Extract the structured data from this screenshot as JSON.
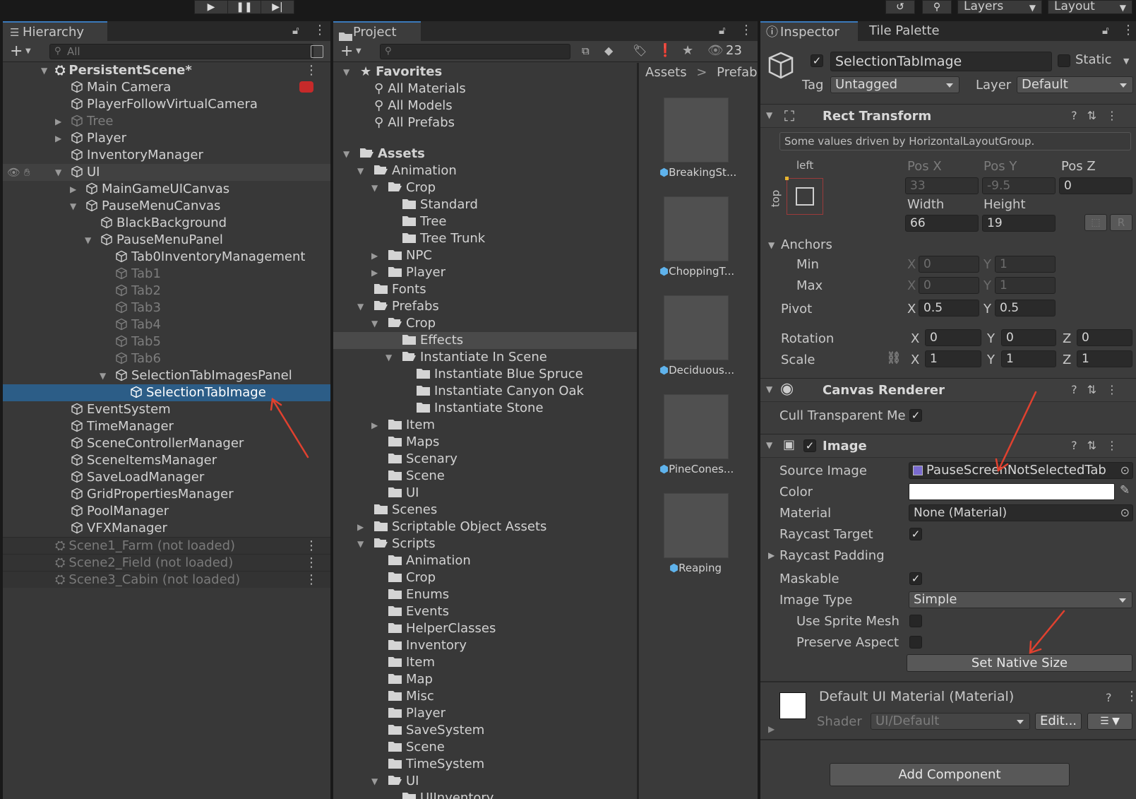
{
  "toolbar": {
    "layers_label": "Layers",
    "layout_label": "Layout"
  },
  "hierarchy": {
    "tab_label": "Hierarchy",
    "search_placeholder": "All",
    "scene_name": "PersistentScene*",
    "items": [
      {
        "label": "Main Camera"
      },
      {
        "label": "PlayerFollowVirtualCamera"
      },
      {
        "label": "Tree"
      },
      {
        "label": "Player"
      },
      {
        "label": "InventoryManager"
      },
      {
        "label": "UI"
      },
      {
        "label": "MainGameUICanvas"
      },
      {
        "label": "PauseMenuCanvas"
      },
      {
        "label": "BlackBackground"
      },
      {
        "label": "PauseMenuPanel"
      },
      {
        "label": "Tab0InventoryManagement"
      },
      {
        "label": "Tab1"
      },
      {
        "label": "Tab2"
      },
      {
        "label": "Tab3"
      },
      {
        "label": "Tab4"
      },
      {
        "label": "Tab5"
      },
      {
        "label": "Tab6"
      },
      {
        "label": "SelectionTabImagesPanel"
      },
      {
        "label": "SelectionTabImage"
      },
      {
        "label": "EventSystem"
      },
      {
        "label": "TimeManager"
      },
      {
        "label": "SceneControllerManager"
      },
      {
        "label": "SceneItemsManager"
      },
      {
        "label": "SaveLoadManager"
      },
      {
        "label": "GridPropertiesManager"
      },
      {
        "label": "PoolManager"
      },
      {
        "label": "VFXManager"
      }
    ],
    "unloaded_scenes": [
      {
        "label": "Scene1_Farm (not loaded)"
      },
      {
        "label": "Scene2_Field (not loaded)"
      },
      {
        "label": "Scene3_Cabin (not loaded)"
      }
    ]
  },
  "project": {
    "tab_label": "Project",
    "hidden_count": "23",
    "breadcrumb": [
      "Assets",
      "Prefabs"
    ],
    "tree": [
      {
        "label": "Favorites"
      },
      {
        "label": "All Materials"
      },
      {
        "label": "All Models"
      },
      {
        "label": "All Prefabs"
      },
      {
        "label": "Assets"
      },
      {
        "label": "Animation"
      },
      {
        "label": "Crop"
      },
      {
        "label": "Standard"
      },
      {
        "label": "Tree"
      },
      {
        "label": "Tree Trunk"
      },
      {
        "label": "NPC"
      },
      {
        "label": "Player"
      },
      {
        "label": "Fonts"
      },
      {
        "label": "Prefabs"
      },
      {
        "label": "Crop"
      },
      {
        "label": "Effects"
      },
      {
        "label": "Instantiate In Scene"
      },
      {
        "label": "Instantiate Blue Spruce"
      },
      {
        "label": "Instantiate Canyon Oak"
      },
      {
        "label": "Instantiate Stone"
      },
      {
        "label": "Item"
      },
      {
        "label": "Maps"
      },
      {
        "label": "Scenary"
      },
      {
        "label": "Scene"
      },
      {
        "label": "UI"
      },
      {
        "label": "Scenes"
      },
      {
        "label": "Scriptable Object Assets"
      },
      {
        "label": "Scripts"
      },
      {
        "label": "Animation"
      },
      {
        "label": "Crop"
      },
      {
        "label": "Enums"
      },
      {
        "label": "Events"
      },
      {
        "label": "HelperClasses"
      },
      {
        "label": "Inventory"
      },
      {
        "label": "Item"
      },
      {
        "label": "Map"
      },
      {
        "label": "Misc"
      },
      {
        "label": "Player"
      },
      {
        "label": "SaveSystem"
      },
      {
        "label": "Scene"
      },
      {
        "label": "TimeSystem"
      },
      {
        "label": "UI"
      },
      {
        "label": "UIInventory"
      }
    ],
    "assets": [
      {
        "label": "BreakingSt..."
      },
      {
        "label": "ChoppingT..."
      },
      {
        "label": "Deciduous..."
      },
      {
        "label": "PineCones..."
      },
      {
        "label": "Reaping"
      }
    ]
  },
  "inspector": {
    "tab_label": "Inspector",
    "tab2_label": "Tile Palette",
    "object_name": "SelectionTabImage",
    "static_label": "Static",
    "tag_label": "Tag",
    "tag_value": "Untagged",
    "layer_label": "Layer",
    "layer_value": "Default",
    "rect": {
      "title": "Rect Transform",
      "driven_note": "Some values driven by HorizontalLayoutGroup.",
      "anchor_h": "left",
      "anchor_v": "top",
      "posx_label": "Pos X",
      "posy_label": "Pos Y",
      "posz_label": "Pos Z",
      "posx": "33",
      "posy": "-9.5",
      "posz": "0",
      "width_label": "Width",
      "height_label": "Height",
      "width": "66",
      "height": "19",
      "r_button": "R",
      "anchors_label": "Anchors",
      "min_label": "Min",
      "max_label": "Max",
      "min_x": "0",
      "min_y": "1",
      "max_x": "0",
      "max_y": "1",
      "pivot_label": "Pivot",
      "pivot_x": "0.5",
      "pivot_y": "0.5",
      "rotation_label": "Rotation",
      "rot_x": "0",
      "rot_y": "0",
      "rot_z": "0",
      "scale_label": "Scale",
      "scale_x": "1",
      "scale_y": "1",
      "scale_z": "1",
      "x": "X",
      "y": "Y",
      "z": "Z"
    },
    "canvas_renderer": {
      "title": "Canvas Renderer",
      "cull_label": "Cull Transparent Me"
    },
    "image": {
      "title": "Image",
      "source_label": "Source Image",
      "source_value": "PauseScreenNotSelectedTab",
      "color_label": "Color",
      "color_value": "#ffffff",
      "material_label": "Material",
      "material_value": "None (Material)",
      "raycast_target_label": "Raycast Target",
      "raycast_padding_label": "Raycast Padding",
      "maskable_label": "Maskable",
      "image_type_label": "Image Type",
      "image_type_value": "Simple",
      "use_sprite_mesh_label": "Use Sprite Mesh",
      "preserve_aspect_label": "Preserve Aspect",
      "set_native_label": "Set Native Size"
    },
    "material": {
      "title": "Default UI Material (Material)",
      "shader_label": "Shader",
      "shader_value": "UI/Default",
      "edit_label": "Edit..."
    },
    "add_component_label": "Add Component"
  },
  "colors": {
    "selection": "#2c5d87",
    "annotation_arrow": "#e0412f",
    "panel_bg": "#383838"
  }
}
